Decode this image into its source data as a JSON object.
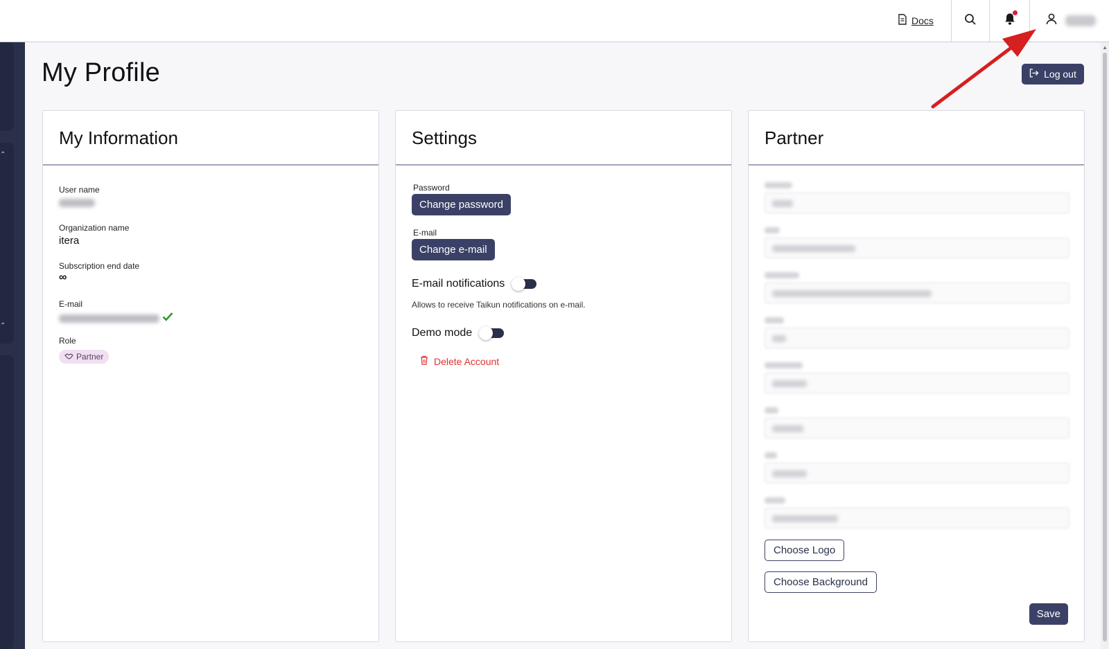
{
  "header": {
    "docs_label": "Docs",
    "notification_dot_color": "#e0194a"
  },
  "page": {
    "title": "My Profile",
    "logout_label": "Log out"
  },
  "my_information": {
    "title": "My Information",
    "user_name_label": "User name",
    "organization_label": "Organization name",
    "organization_value": "itera",
    "subscription_label": "Subscription end date",
    "subscription_value": "∞",
    "email_label": "E-mail",
    "role_label": "Role",
    "role_value": "Partner"
  },
  "settings": {
    "title": "Settings",
    "password_label": "Password",
    "change_password_label": "Change password",
    "email_label": "E-mail",
    "change_email_label": "Change e-mail",
    "email_notifications_label": "E-mail notifications",
    "email_notifications_hint": "Allows to receive Taikun notifications on e-mail.",
    "email_notifications_on": false,
    "demo_mode_label": "Demo mode",
    "demo_mode_on": false,
    "delete_account_label": "Delete Account"
  },
  "partner": {
    "title": "Partner",
    "choose_logo_label": "Choose Logo",
    "choose_background_label": "Choose Background",
    "save_label": "Save"
  },
  "colors": {
    "primary": "#3b4166",
    "sidebar": "#2a3049",
    "danger": "#e03131",
    "verified": "#2e9a2e",
    "annotation_arrow": "#d61f1f"
  }
}
